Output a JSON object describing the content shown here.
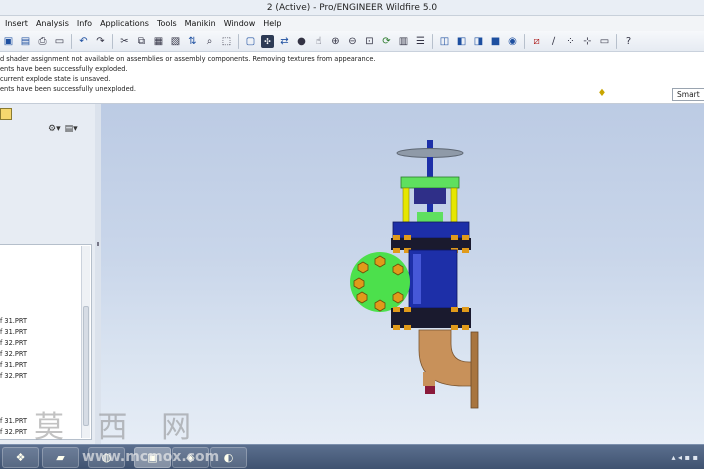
{
  "window": {
    "title": "2 (Active) - Pro/ENGINEER Wildfire 5.0"
  },
  "menu": [
    "Insert",
    "Analysis",
    "Info",
    "Applications",
    "Tools",
    "Manikin",
    "Window",
    "Help"
  ],
  "messages": [
    "d shader assignment not available on assemblies or assembly components. Removing textures from appearance.",
    "ents have been successfully exploded.",
    " current explode state is unsaved.",
    "ents have been successfully unexploded."
  ],
  "filter": {
    "value": "Smart"
  },
  "tree": {
    "items": [
      "f 31.PRT",
      "f 31.PRT",
      "f 32.PRT",
      "f 32.PRT",
      "f 31.PRT",
      "f 32.PRT",
      "f 31.PRT",
      "f 32.PRT"
    ]
  },
  "watermark": {
    "chinese": "莫 西 网",
    "url": "www.mcmox.com"
  },
  "colors": {
    "viewport_top": "#bccbe4",
    "viewport_bottom": "#e6edf6",
    "handwheel": "#8f9aa8",
    "yoke": "#5fe05f",
    "rods": "#e6e600",
    "body": "#1d2fa8",
    "flange": "#4ce04c",
    "bolts": "#e09a1a",
    "elbow": "#c8915a"
  }
}
